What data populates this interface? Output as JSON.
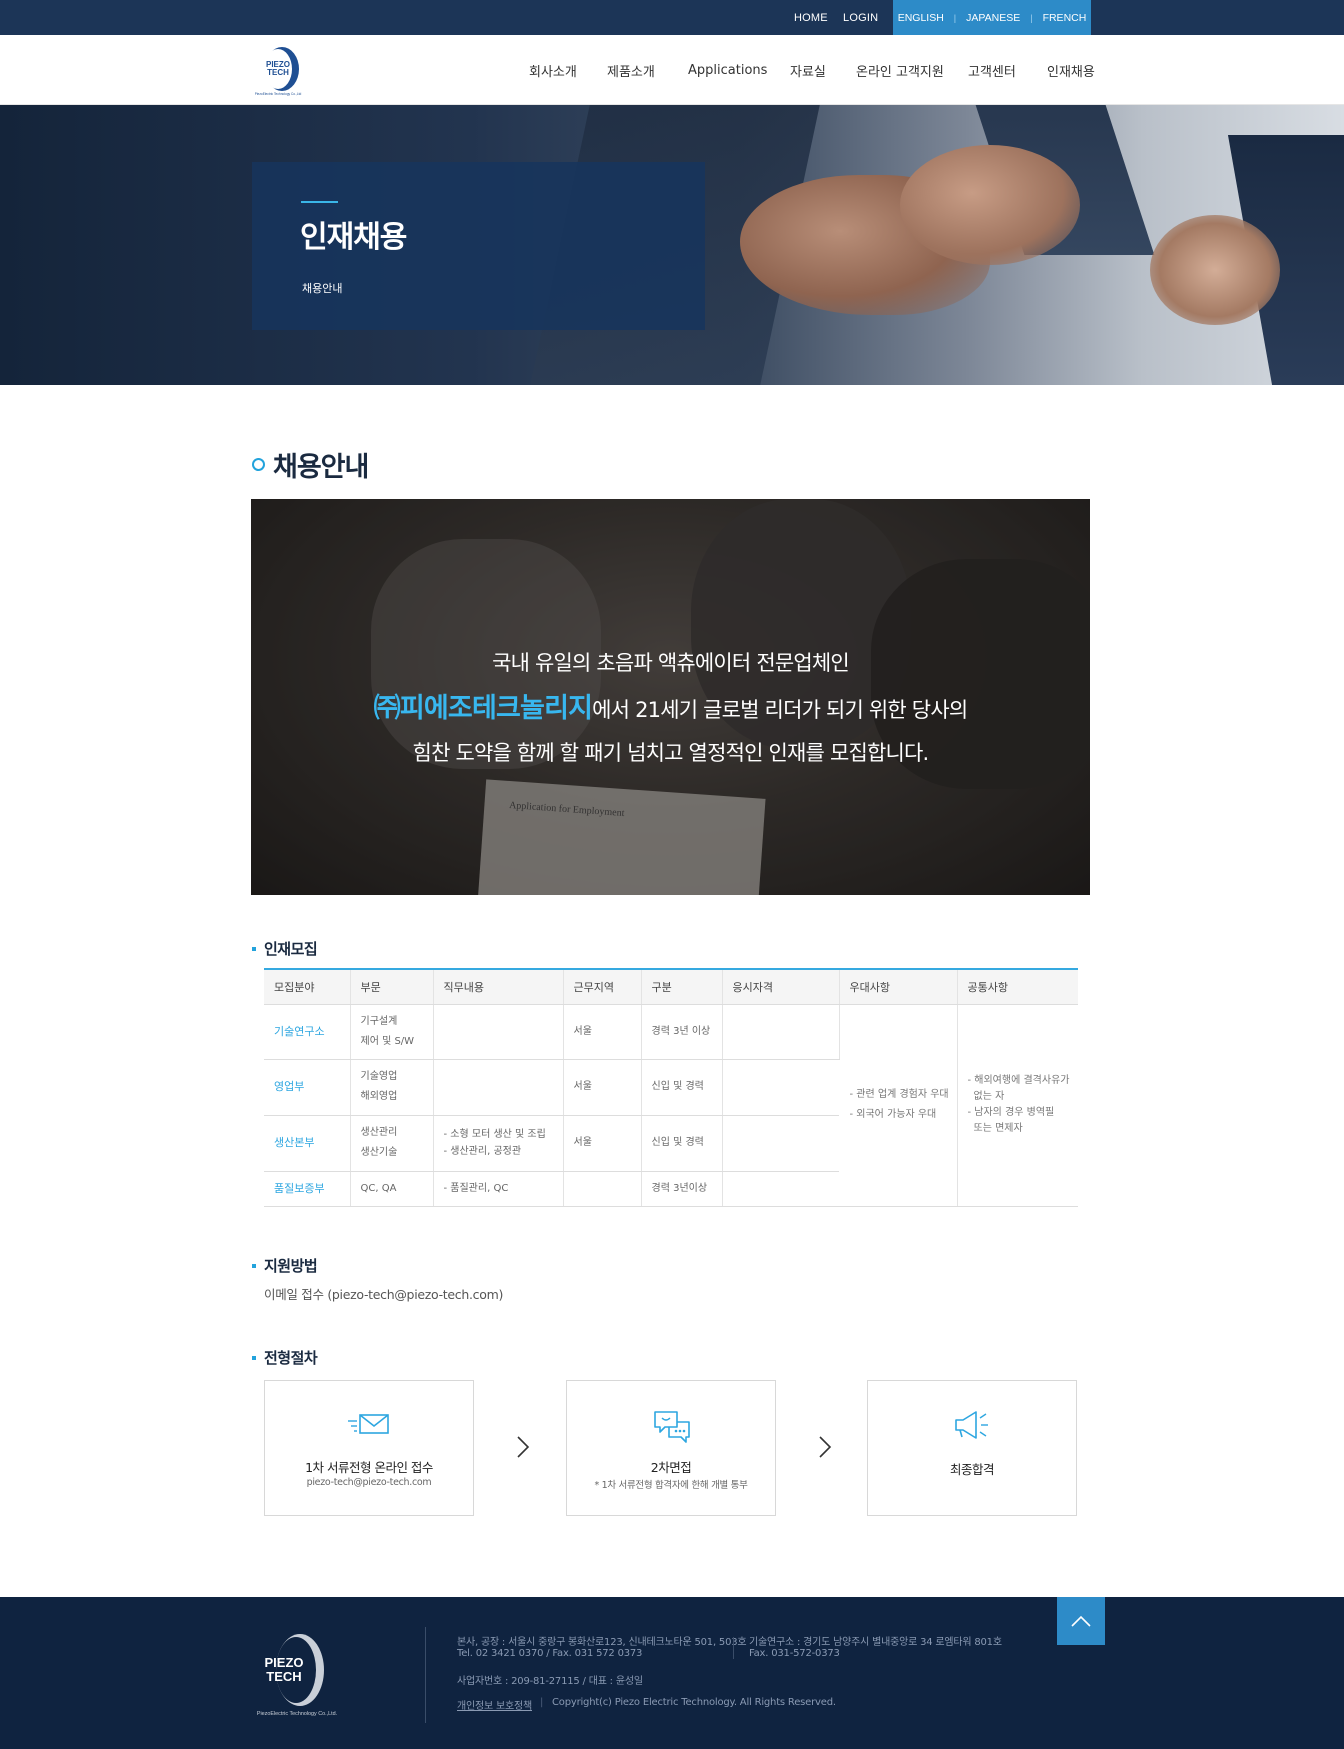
{
  "topbar": {
    "home": "HOME",
    "login": "LOGIN",
    "languages": [
      "ENGLISH",
      "JAPANESE",
      "FRENCH"
    ]
  },
  "header": {
    "logo_text_1": "PIEZO",
    "logo_text_2": "TECH",
    "logo_sub": "PiezoElectric Technology Co.,Ltd",
    "nav": [
      "회사소개",
      "제품소개",
      "Applications",
      "자료실",
      "온라인 고객지원",
      "고객센터",
      "인재채용"
    ]
  },
  "hero": {
    "title": "인재채용",
    "subtitle": "채용안내"
  },
  "section": {
    "title": "채용안내"
  },
  "banner": {
    "line1": "국내 유일의 초음파 액츄에이터 전문업체인",
    "line2_highlight": "㈜피에조테크놀리지",
    "line2_rest": "에서 21세기 글로벌 리더가 되기 위한 당사의",
    "line3": "힘찬 도약을 함께 할 패기 넘치고 열정적인 인재를 모집합니다.",
    "paper_title": "Application for Employment"
  },
  "recruit": {
    "title": "인재모집",
    "headers": [
      "모집분야",
      "부문",
      "직무내용",
      "근무지역",
      "구분",
      "응시자격",
      "우대사항",
      "공통사항"
    ],
    "rows": [
      {
        "field": "기술연구소",
        "part": [
          "기구설계",
          "제어 및 S/W"
        ],
        "duty": [],
        "location": "서울",
        "type": "경력 3년 이상"
      },
      {
        "field": "영업부",
        "part": [
          "기술영업",
          "해외영업"
        ],
        "duty": [],
        "location": "서울",
        "type": "신입 및 경력"
      },
      {
        "field": "생산본부",
        "part": [
          "생산관리",
          "생산기술"
        ],
        "duty": [
          "- 소형 모터 생산 및 조립",
          "- 생산관리, 공정관"
        ],
        "location": "서울",
        "type": "신입 및 경력"
      },
      {
        "field": "품질보증부",
        "part": [
          "QC, QA"
        ],
        "duty": [
          "- 품질관리, QC"
        ],
        "location": "",
        "type": "경력 3년이상"
      }
    ],
    "benefits": [
      "- 관련 업계 경험자 우대",
      "- 외국어 가능자 우대"
    ],
    "common": [
      "- 해외여행에 결격사유가",
      "없는 자",
      "- 남자의 경우 병역필",
      "또는 면제자"
    ]
  },
  "apply": {
    "title": "지원방법",
    "text": "이메일 접수 (piezo-tech@piezo-tech.com)"
  },
  "process": {
    "title": "전형절차",
    "steps": [
      {
        "icon": "envelope-icon",
        "label": "1차 서류전형 온라인 접수",
        "note": "piezo-tech@piezo-tech.com"
      },
      {
        "icon": "chat-icon",
        "label": "2차면접",
        "note": "* 1차 서류전형 합격자에 한해 개별 통부"
      },
      {
        "icon": "megaphone-icon",
        "label": "최종합격",
        "note": ""
      }
    ]
  },
  "footer": {
    "logo_text_1": "PIEZO",
    "logo_text_2": "TECH",
    "logo_sub": "PiezoElectric Technology Co.,Ltd.",
    "address": "본사, 공장 : 서울시 중랑구 봉화산로123, 신내테크노타운 501, 503호",
    "tel": "Tel. 02 3421 0370  /  Fax. 031 572 0373",
    "lab_address": "기술연구소 : 경기도 남양주시 별내중앙로 34 로엠타워 801호",
    "lab_fax": "Fax. 031-572-0373",
    "biz": "사업자번호 : 209-81-27115  /  대표 : 윤성일",
    "privacy": "개인정보 보호정책",
    "copyright": "Copyright(c) Piezo Electric Technology. All Rights Reserved."
  },
  "colors": {
    "navy": "#1c3557",
    "accent_blue": "#2d8bc8",
    "highlight": "#38b7ef",
    "footer_bg": "#0f2340"
  }
}
